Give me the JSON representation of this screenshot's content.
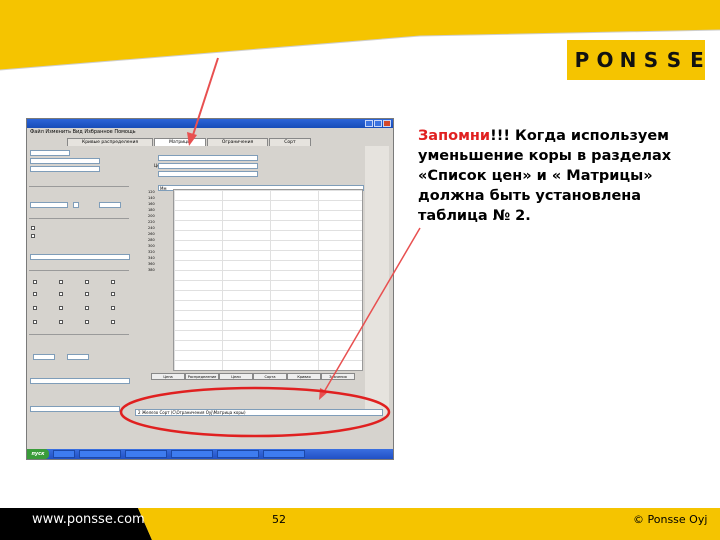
{
  "logo": {
    "letters": [
      "P",
      "O",
      "N",
      "S",
      "S",
      "E"
    ]
  },
  "note": {
    "lead": "Запомни",
    "body": "!!! Когда используем уменьшение коры в разделах «Список цен» и « Матрицы» должна быть установлена таблица № 2."
  },
  "footer": {
    "website": "www.ponsse.com",
    "page_number": "52",
    "copyright": "© Ponsse Oyj"
  },
  "screenshot": {
    "menu": "Файл  Изменить  Вид  Избранное  Помощь",
    "tabs": [
      "Кривые распределения",
      "Матрицы",
      "Ограничения",
      "Сорт"
    ],
    "bottom_tabs": [
      "Цена",
      "Распределение",
      "Цели",
      "Сорта",
      "Кривая",
      "Значения"
    ],
    "table_path": "2 Железо Сорт (С\\Ограничения Оуј\\Матрица коры)",
    "start_label": "пуск",
    "price_label": "Цена",
    "dia_label": "Мм",
    "grid_rows": [
      "120",
      "140",
      "160",
      "180",
      "200",
      "220",
      "240",
      "260",
      "280",
      "300",
      "320",
      "340",
      "360",
      "380"
    ]
  },
  "colors": {
    "brand_yellow": "#f5c400",
    "accent_red": "#e02020",
    "footer_black": "#000000"
  }
}
